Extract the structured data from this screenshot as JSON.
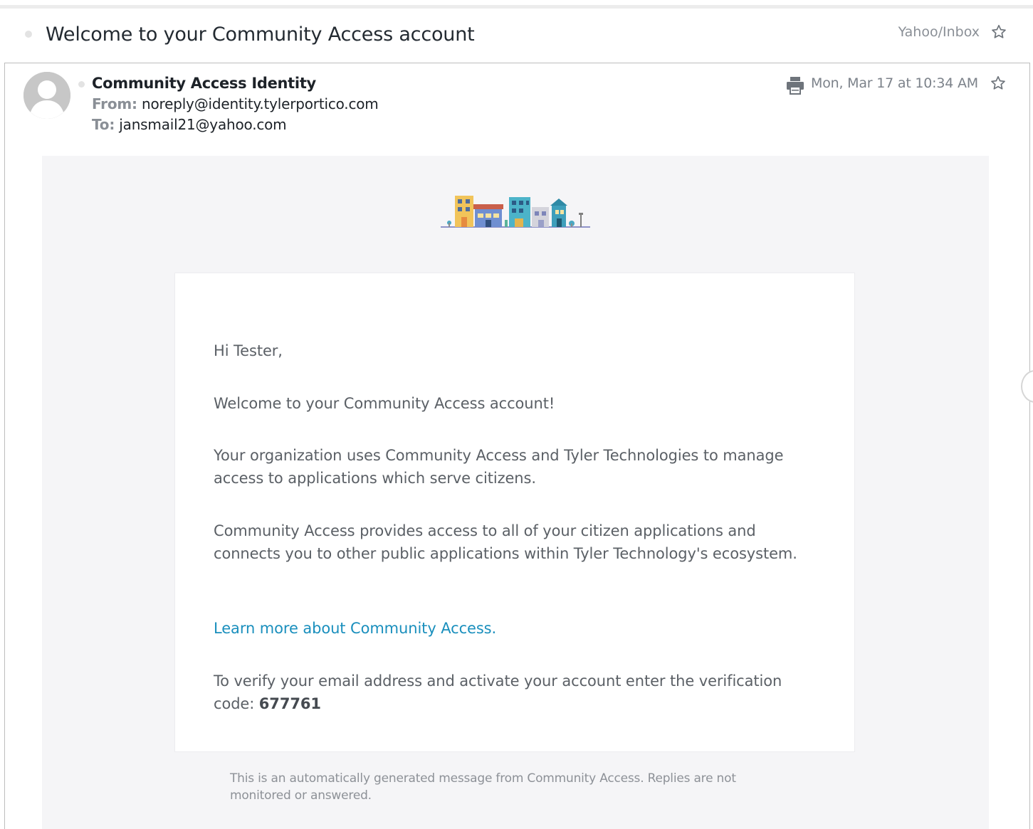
{
  "subject": {
    "title": "Welcome to your Community Access account",
    "folder": "Yahoo/Inbox"
  },
  "message": {
    "sender_name": "Community Access Identity",
    "from_label": "From:",
    "from_address": "noreply@identity.tylerportico.com",
    "to_label": "To:",
    "to_address": "jansmail21@yahoo.com",
    "date": "Mon, Mar 17 at 10:34 AM"
  },
  "body": {
    "greeting": "Hi Tester,",
    "welcome": "Welcome to your Community Access account!",
    "org_paragraph": "Your organization uses Community Access and Tyler Technologies to manage access to applications which serve citizens.",
    "provides_paragraph": "Community Access provides access to all of your citizen applications and connects you to other public applications within Tyler Technology's ecosystem.",
    "learn_more_link": "Learn more about Community Access.",
    "verify_text": "To verify your email address and activate your account enter the verification code: ",
    "verification_code": "677761",
    "footer": "This is an automatically generated message from Community Access. Replies are not monitored or answered."
  },
  "icons": {
    "subject_star": "star-outline-icon",
    "message_star": "star-outline-icon",
    "print": "print-icon",
    "avatar": "default-avatar-icon",
    "logo": "community-buildings-logo"
  },
  "colors": {
    "link": "#1a8fbd",
    "body_background": "#f5f5f7",
    "muted_text": "#8a8f96"
  }
}
